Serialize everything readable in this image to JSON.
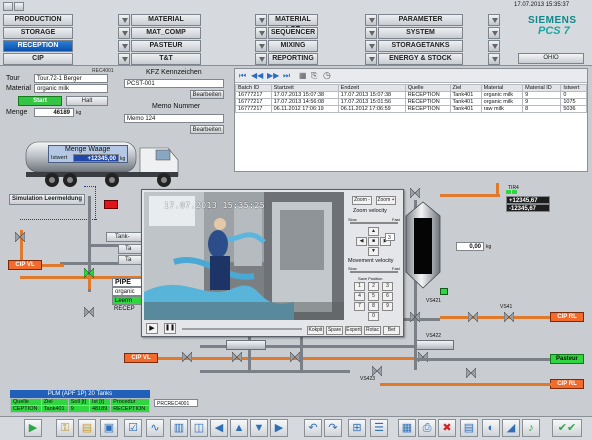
{
  "nav": {
    "row1": [
      "PRODUCTION",
      "MATERIAL",
      "MATERIAL LOT",
      "PARAMETER"
    ],
    "row2": [
      "STORAGE",
      "MAT_COMP",
      "SEQUENCER",
      "SYSTEM"
    ],
    "row3": [
      "RECEPTION",
      "PASTEUR",
      "MIXING",
      "STORAGETANKS"
    ],
    "row4": [
      "CIP",
      "T&T",
      "REPORTING",
      "ENERGY & STOCK"
    ]
  },
  "header": {
    "datetime": "17.07.2013 15:35:37",
    "brand": "SIEMENS",
    "product": "PCS 7",
    "station": "OHIO"
  },
  "left_panel": {
    "tag": "REC4001",
    "tour_label": "Tour",
    "tour_value": "Tour.72-1 Berger",
    "material_label": "Material",
    "material_value": "organic milk",
    "start": "Start",
    "halt": "Halt",
    "menge_label": "Menge",
    "menge_value": "46189",
    "menge_unit": "kg"
  },
  "kfz": {
    "title": "KFZ Kennzeichen",
    "value": "PCST-001",
    "edit": "Bearbeiten",
    "memo_title": "Memo Nummer",
    "memo_value": "Memo 124",
    "memo_edit": "Bearbeiten"
  },
  "batch_table": {
    "headers": [
      "Batch ID",
      "Startzeit",
      "Endzeit",
      "Quelle",
      "Ziel",
      "Material",
      "Material ID",
      "Istwert"
    ],
    "rows": [
      [
        "16777217",
        "17.07.2013 15:07:38",
        "17.07.2013 15:07:38",
        "RECEPTION",
        "Tank401",
        "organic milk",
        "9",
        "0"
      ],
      [
        "16777217",
        "17.07.2013 14:56:08",
        "17.07.2013 15:01:56",
        "RECEPTION",
        "Tank401",
        "organic milk",
        "9",
        "1075"
      ],
      [
        "16777217",
        "06.11.2012 17:06:19",
        "06.11.2012 17:06:59",
        "RECEPTION",
        "Tank401",
        "raw milk",
        "8",
        "5036"
      ]
    ]
  },
  "truck": {
    "title": "Menge Waage",
    "istwert_label": "Istwert",
    "istwert_value": "+12345,00",
    "unit": "kg"
  },
  "process": {
    "sim_button": "Simulation Leermeldung",
    "tank_labels": [
      "Tank-",
      "Ta",
      "Ta"
    ],
    "pipe_label": "PIPE",
    "organic": "organic",
    "lable_green": "Leerm",
    "recep": "RECEP",
    "cip_vl_1": "CIP VL",
    "cip_vl_2": "CIP VL",
    "cip_rl_1": "CIP RL",
    "cip_rl_2": "CIP RL",
    "pasteur": "Pasteur",
    "tank_value": "0,00",
    "tank_unit": "kg",
    "val_a": "+12345,67",
    "val_b": "-12345,67",
    "tag_a": "TIR4",
    "tag_vs421": "VS421",
    "tag_vs418": "VS418",
    "tag_vs422": "VS422",
    "tag_v1": "VS41",
    "tag_vs423": "VS423"
  },
  "camera": {
    "timestamp": "17.07.2013  15:35:25",
    "zoom_label": "Zoom velocity",
    "movement_label": "Movement velocity",
    "zoom_btns": [
      "Zoom -",
      "Zoom +"
    ],
    "slow": "Slow",
    "fast": "Fast",
    "save": "Save Position",
    "pos_values": [
      "1",
      "2",
      "3",
      "4",
      "5",
      "6",
      "7",
      "8",
      "9",
      "",
      "0",
      ""
    ],
    "preset": "3",
    "tabs": [
      "Kokpit",
      "Spare",
      "Expert",
      "Rotac",
      "Bet"
    ]
  },
  "plm": {
    "title": "PLM (APF 1P) 20 Tanks",
    "headers": [
      "Quelle",
      "Ziel",
      "Soll [t]",
      "Ist [t]",
      "Procedur"
    ],
    "row": [
      "CEPTION",
      "Tank401",
      "9",
      "48189",
      "RECEPTION"
    ],
    "tag": "PRCREC4001"
  }
}
